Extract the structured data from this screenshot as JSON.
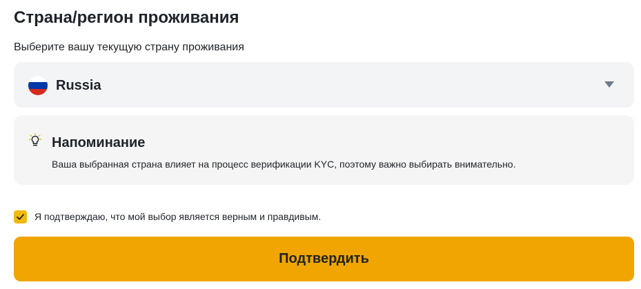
{
  "page": {
    "title": "Страна/регион проживания",
    "subtitle": "Выберите вашу текущую страну проживания"
  },
  "country_select": {
    "selected_value": "Russia",
    "flag_icon": "russia-flag-icon",
    "flag_colors": [
      "#ffffff",
      "#0039a6",
      "#d52b1e"
    ],
    "dropdown_icon": "caret-down-icon"
  },
  "reminder": {
    "icon": "lightbulb-icon",
    "title": "Напоминание",
    "text": "Ваша выбранная страна влияет на процесс верификации KYC, поэтому важно выбирать внимательно."
  },
  "confirmation": {
    "checked": true,
    "label": "Я подтверждаю, что мой выбор является верным и правдивым."
  },
  "submit": {
    "label": "Подтвердить"
  },
  "colors": {
    "accent": "#f0a500",
    "checkbox": "#f0b90b",
    "panel_background": "#f3f4f6",
    "text": "#1e2329"
  }
}
